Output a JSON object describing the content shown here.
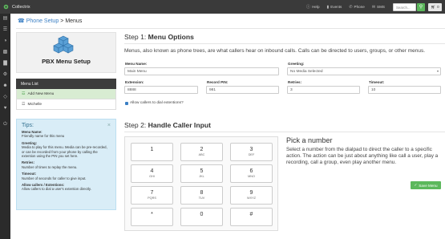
{
  "app": {
    "title": "Collectrix"
  },
  "topnav": {
    "help": "Help",
    "events": "Events",
    "phone": "Phone",
    "sms": "SMS",
    "search_placeholder": "Search...",
    "cart_count": "0"
  },
  "breadcrumb": {
    "parent": "Phone Setup",
    "separator": ">",
    "current": "Menus"
  },
  "left": {
    "pbx_title": "PBX Menu Setup",
    "menu_list_title": "Menu List",
    "items": [
      "Add New Menu",
      "Michelle"
    ]
  },
  "tips": {
    "title": "Tips:",
    "entries": [
      {
        "name": "Menu Name:",
        "text": "Friendly name for this menu"
      },
      {
        "name": "Greeting:",
        "text": "Media to play for this menu. Media can be pre-recorded, or can be recorded from your phone by calling the extention using the PIN you set here."
      },
      {
        "name": "Retries:",
        "text": "Number of times to replay the menu."
      },
      {
        "name": "Timeout:",
        "text": "Number of seconds for caller to give input."
      },
      {
        "name": "Allow callers / Extentions:",
        "text": "Allow callers to dial a user's extention directly."
      }
    ]
  },
  "step1": {
    "prefix": "Step 1:",
    "title": "Menu Options",
    "intro": "Menus, also known as phone trees, are what callers hear on inbound calls. Calls can be directed to users, groups, or other menus."
  },
  "form": {
    "menu_name_label": "Menu Name:",
    "menu_name_value": "Main Menu",
    "greeting_label": "Greeting:",
    "greeting_value": "No Media Selected",
    "extension_label": "Extension:",
    "extension_value": "8888",
    "record_pin_label": "Record PIN:",
    "record_pin_value": "981",
    "retries_label": "Retries:",
    "retries_value": "3",
    "timeout_label": "Timeout:",
    "timeout_value": "10",
    "allow_label": "Allow callers to dial extentions?"
  },
  "step2": {
    "prefix": "Step 2:",
    "title": "Handle Caller Input"
  },
  "keypad": [
    {
      "num": "1",
      "sub": ""
    },
    {
      "num": "2",
      "sub": "ABC"
    },
    {
      "num": "3",
      "sub": "DEF"
    },
    {
      "num": "4",
      "sub": "GHI"
    },
    {
      "num": "5",
      "sub": "JKL"
    },
    {
      "num": "6",
      "sub": "MNO"
    },
    {
      "num": "7",
      "sub": "PQRS"
    },
    {
      "num": "8",
      "sub": "TUV"
    },
    {
      "num": "9",
      "sub": "WXYZ"
    },
    {
      "num": "*",
      "sub": ""
    },
    {
      "num": "0",
      "sub": ""
    },
    {
      "num": "#",
      "sub": ""
    }
  ],
  "pick": {
    "title": "Pick a number",
    "text": "Select a number from the dialpad to direct the caller to a specific action. The action can be just about anything like call a user, play a recording, call a group, even play another menu."
  },
  "save_label": "Save Menu",
  "colors": {
    "accent": "#3b7fc4",
    "success": "#5cb85c",
    "topbar": "#3a3a3a",
    "rail": "#2b2b2b",
    "tips_bg": "#d9edf7"
  }
}
